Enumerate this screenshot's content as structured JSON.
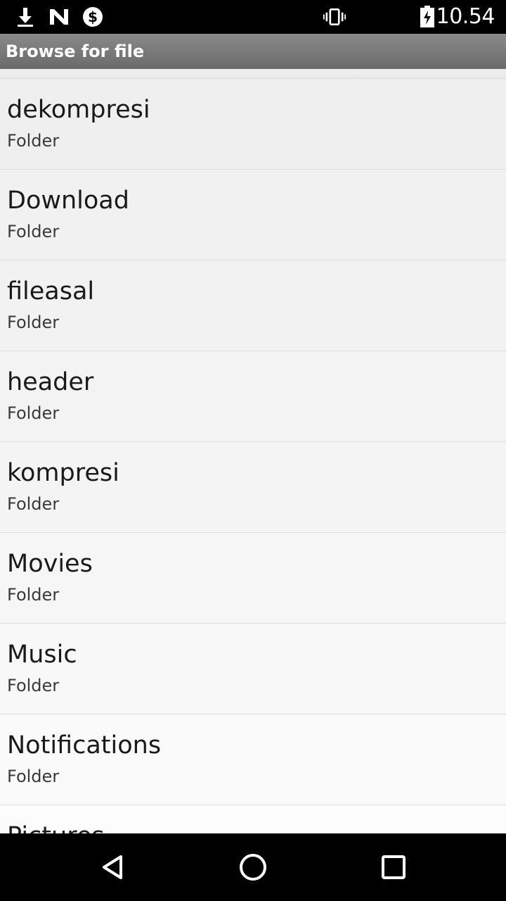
{
  "status_bar": {
    "icons": [
      "download-icon",
      "app-n-icon",
      "dollar-icon",
      "vibrate-icon",
      "battery-charging-icon"
    ],
    "time": "10.54"
  },
  "header": {
    "title": "Browse for file"
  },
  "list": {
    "items": [
      {
        "name": "dekompresi",
        "kind": "Folder"
      },
      {
        "name": "Download",
        "kind": "Folder"
      },
      {
        "name": "fileasal",
        "kind": "Folder"
      },
      {
        "name": "header",
        "kind": "Folder"
      },
      {
        "name": "kompresi",
        "kind": "Folder"
      },
      {
        "name": "Movies",
        "kind": "Folder"
      },
      {
        "name": "Music",
        "kind": "Folder"
      },
      {
        "name": "Notifications",
        "kind": "Folder"
      },
      {
        "name": "Pictures",
        "kind": ""
      }
    ]
  },
  "nav_bar": {
    "icons": [
      "back-icon",
      "home-icon",
      "recents-icon"
    ]
  }
}
